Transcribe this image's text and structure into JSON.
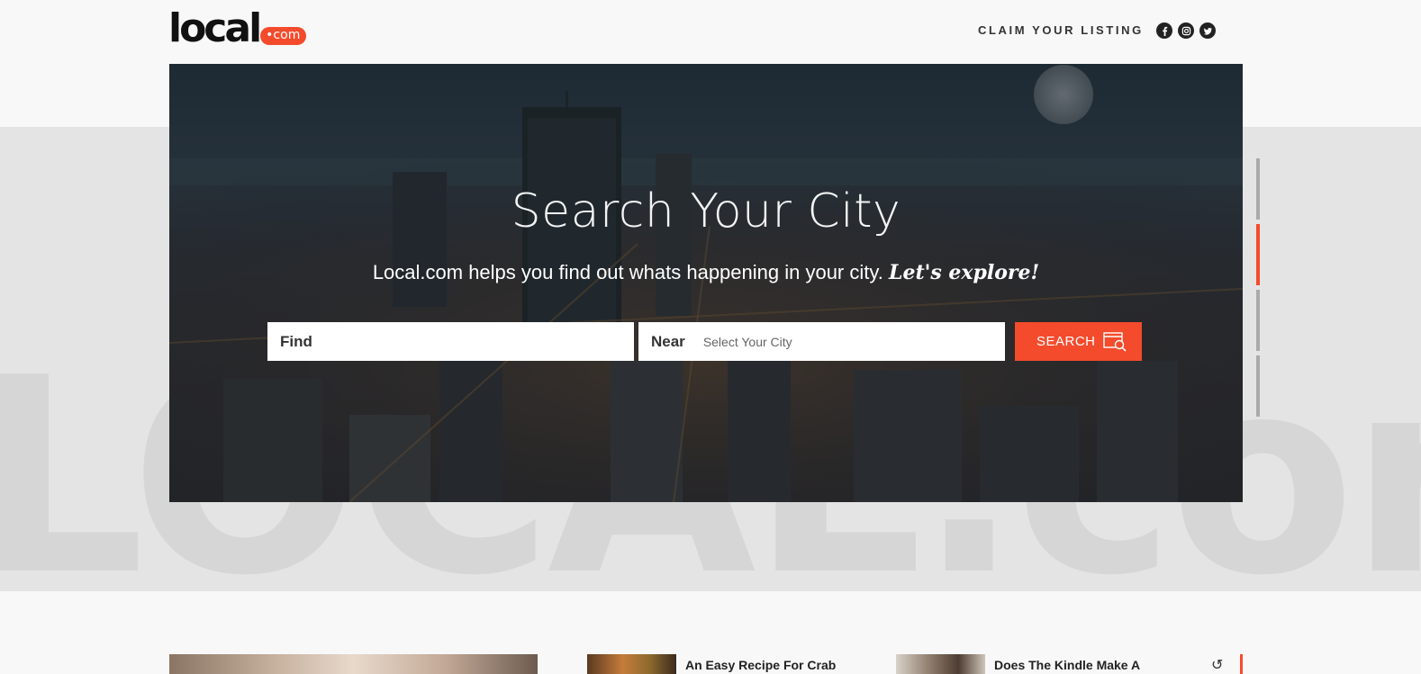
{
  "brand": {
    "word": "local",
    "suffix": "•com",
    "accent_color": "#f44b2c"
  },
  "watermark": "LOCAL.com",
  "header": {
    "claim_label": "CLAIM YOUR LISTING",
    "social_icons": [
      "facebook-icon",
      "instagram-icon",
      "twitter-icon"
    ]
  },
  "hero": {
    "title": "Search Your City",
    "subtitle": "Local.com helps you find out whats happening in your city.",
    "subtitle_emphasis": "Let's explore!",
    "find_label": "Find",
    "find_value": "",
    "near_label": "Near",
    "near_placeholder": "Select Your City",
    "search_button": "SEARCH"
  },
  "slider": {
    "count": 4,
    "active_index": 1
  },
  "articles": [
    {
      "title": ""
    },
    {
      "title": "An Easy Recipe For Crab"
    },
    {
      "title": "Does The Kindle Make A"
    }
  ],
  "refresh_icon": "refresh-icon"
}
